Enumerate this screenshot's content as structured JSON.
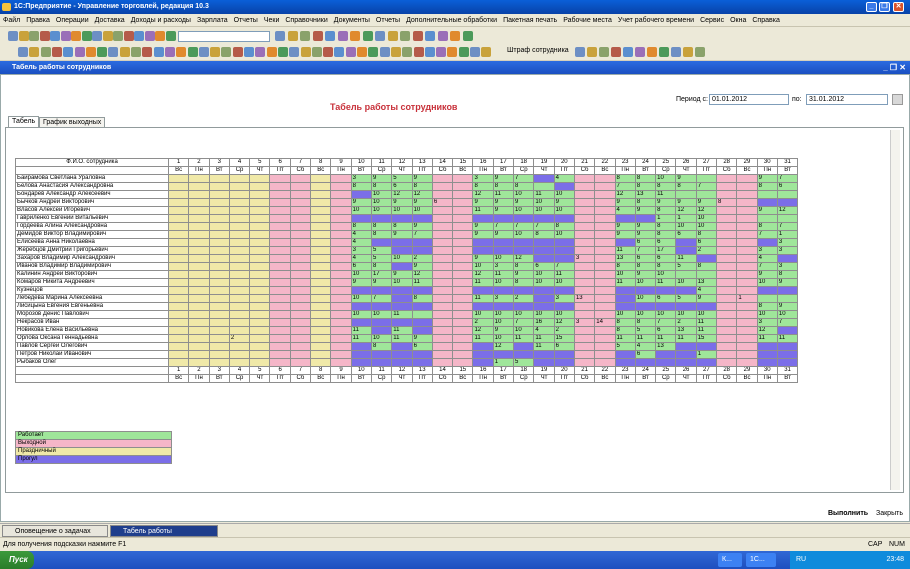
{
  "window": {
    "title": "1С:Предприятие - Управление торговлей, редакция 10.3",
    "min": "_",
    "restore": "❐",
    "close": "✕"
  },
  "menu": [
    "Файл",
    "Правка",
    "Операции",
    "Доставка",
    "Доходы и расходы",
    "Зарплата",
    "Отчеты",
    "Чеки",
    "Справочники",
    "Документы",
    "Отчеты",
    "Дополнительные обработки",
    "Пакетная печать",
    "Рабочие места",
    "Учет рабочего времени",
    "Сервис",
    "Окна",
    "Справка"
  ],
  "toolbar": {
    "search_placeholder": "",
    "penalty_label": "Штраф сотрудника"
  },
  "doc": {
    "title": "Табель работы сотрудников"
  },
  "report": {
    "title": "Табель работы сотрудников",
    "period_from_label": "Период с:",
    "period_from": "01.01.2012",
    "period_to_label": "по:",
    "period_to": "31.01.2012",
    "tabs": [
      "Табель",
      "График выходных"
    ],
    "name_header": "Ф.И.О. сотрудника",
    "days": [
      "1",
      "2",
      "3",
      "4",
      "5",
      "6",
      "7",
      "8",
      "9",
      "10",
      "11",
      "12",
      "13",
      "14",
      "15",
      "16",
      "17",
      "18",
      "19",
      "20",
      "21",
      "22",
      "23",
      "24",
      "25",
      "26",
      "27",
      "28",
      "29",
      "30",
      "31"
    ],
    "weekdays": [
      "Вс",
      "Пн",
      "Вт",
      "Ср",
      "Чт",
      "Пт",
      "Сб",
      "Вс",
      "Пн",
      "Вт",
      "Ср",
      "Чт",
      "Пт",
      "Сб",
      "Вс",
      "Пн",
      "Вт",
      "Ср",
      "Чт",
      "Пт",
      "Сб",
      "Вс",
      "Пн",
      "Вт",
      "Ср",
      "Чт",
      "Пт",
      "Сб",
      "Вс",
      "Пн",
      "Вт"
    ],
    "day_types": [
      "hol",
      "hol",
      "hol",
      "hol",
      "hol",
      "off",
      "off",
      "hol",
      "off",
      "",
      "",
      "",
      "",
      "off",
      "off",
      "",
      "",
      "",
      "",
      "",
      "off",
      "off",
      "",
      "",
      "",
      "",
      "",
      "off",
      "off",
      "",
      ""
    ],
    "rows": [
      {
        "name": "Байрамова Светлана Ураловна",
        "cells": {
          "10": "3",
          "11": "9",
          "12": "5",
          "13": "9",
          "16": "3",
          "17": "9",
          "18": "7",
          "20": "4",
          "23": "8",
          "24": "8",
          "25": "10",
          "26": "9",
          "30": "9",
          "31": "7"
        }
      },
      {
        "name": "Белова Анастасия Александровна",
        "cells": {
          "10": "8",
          "11": "8",
          "12": "6",
          "13": "8",
          "16": "8",
          "17": "8",
          "18": "8",
          "23": "7",
          "24": "8",
          "25": "8",
          "26": "8",
          "27": "7",
          "30": "8",
          "31": "6"
        }
      },
      {
        "name": "Бондарев Александр Алексеевич",
        "cells": {
          "11": "10",
          "12": "12",
          "13": "12",
          "16": "12",
          "17": "11",
          "18": "10",
          "19": "11",
          "20": "10",
          "23": "12",
          "24": "13",
          "25": "11"
        }
      },
      {
        "name": "Бычков Андрей Викторович",
        "cells": {
          "10": "9",
          "11": "10",
          "12": "9",
          "13": "9",
          "14": "6",
          "16": "9",
          "17": "9",
          "18": "9",
          "19": "10",
          "20": "9",
          "23": "9",
          "24": "8",
          "25": "9",
          "26": "9",
          "27": "9",
          "28": "8"
        }
      },
      {
        "name": "Власов Алексей Игоревич",
        "cells": {
          "10": "10",
          "11": "10",
          "12": "10",
          "13": "10",
          "16": "11",
          "17": "9",
          "18": "10",
          "19": "10",
          "20": "10",
          "23": "4",
          "24": "9",
          "25": "8",
          "26": "12",
          "27": "12",
          "30": "9",
          "31": "12"
        }
      },
      {
        "name": "Гавриленко Евгений Витальевич",
        "cells": {
          "25": "1",
          "26": "1",
          "27": "10"
        }
      },
      {
        "name": "Гордеева Алина Александровна",
        "cells": {
          "10": "8",
          "11": "8",
          "12": "8",
          "13": "9",
          "16": "9",
          "17": "7",
          "18": "7",
          "19": "7",
          "20": "8",
          "23": "9",
          "24": "9",
          "25": "8",
          "26": "10",
          "27": "10",
          "30": "8",
          "31": "7"
        }
      },
      {
        "name": "Демидов Виктор Владимирович",
        "cells": {
          "10": "4",
          "11": "8",
          "12": "9",
          "13": "7",
          "16": "9",
          "17": "9",
          "18": "10",
          "19": "8",
          "20": "10",
          "23": "9",
          "24": "9",
          "25": "8",
          "26": "6",
          "27": "8",
          "30": "7",
          "31": "1"
        }
      },
      {
        "name": "Елисеева Анна Николаевна",
        "cells": {
          "10": "4",
          "24": "6",
          "25": "6",
          "27": "6",
          "31": "3"
        }
      },
      {
        "name": "Жеребцов Дмитрий Григорьевич",
        "cells": {
          "10": "3",
          "11": "5",
          "23": "11",
          "24": "7",
          "25": "17",
          "27": "2",
          "30": "3",
          "31": "3"
        }
      },
      {
        "name": "Захаров Владимир Александрович",
        "cells": {
          "10": "4",
          "11": "5",
          "12": "10",
          "13": "2",
          "16": "9",
          "17": "10",
          "18": "12",
          "21": "3",
          "23": "13",
          "24": "6",
          "25": "6",
          "26": "11",
          "30": "4"
        }
      },
      {
        "name": "Иванов Владимир Владимирович",
        "cells": {
          "10": "6",
          "11": "8",
          "13": "9",
          "16": "10",
          "17": "3",
          "18": "8",
          "19": "6",
          "20": "7",
          "23": "8",
          "24": "8",
          "25": "8",
          "26": "5",
          "27": "8",
          "30": "7",
          "31": "3"
        }
      },
      {
        "name": "Калинин Андрей Викторович",
        "cells": {
          "10": "10",
          "11": "17",
          "12": "9",
          "13": "12",
          "16": "12",
          "17": "11",
          "18": "9",
          "19": "10",
          "20": "11",
          "23": "10",
          "24": "9",
          "25": "10",
          "30": "9",
          "31": "8"
        }
      },
      {
        "name": "Комаров Никита Андреевич",
        "cells": {
          "10": "9",
          "11": "9",
          "12": "10",
          "13": "11",
          "16": "11",
          "17": "10",
          "18": "8",
          "19": "10",
          "20": "10",
          "23": "11",
          "24": "10",
          "25": "11",
          "26": "10",
          "27": "13",
          "30": "10",
          "31": "9"
        }
      },
      {
        "name": "Кузнецов",
        "cells": {
          "27": "4"
        }
      },
      {
        "name": "Лебедева Марина Алексеевна",
        "cells": {
          "10": "10",
          "11": "7",
          "13": "8",
          "16": "11",
          "17": "3",
          "18": "2",
          "20": "3",
          "21": "13",
          "24": "10",
          "25": "6",
          "26": "5",
          "27": "9",
          "29": "1"
        }
      },
      {
        "name": "Лисицына Евгения Евгеньевна",
        "cells": {
          "30": "8",
          "31": "9"
        }
      },
      {
        "name": "Морозов Денис Павлович",
        "cells": {
          "10": "10",
          "11": "10",
          "12": "11",
          "16": "10",
          "17": "10",
          "18": "10",
          "19": "10",
          "20": "10",
          "23": "10",
          "24": "10",
          "25": "10",
          "26": "10",
          "27": "10",
          "30": "10",
          "31": "10"
        }
      },
      {
        "name": "Некрасов Иван",
        "cells": {
          "16": "2",
          "17": "10",
          "18": "7",
          "19": "16",
          "20": "12",
          "21": "3",
          "22": "14",
          "23": "8",
          "24": "8",
          "25": "7",
          "26": "2",
          "27": "11",
          "30": "3",
          "31": "7"
        }
      },
      {
        "name": "Новикова Елена Васильевна",
        "cells": {
          "10": "11",
          "12": "11",
          "16": "12",
          "17": "9",
          "18": "10",
          "19": "4",
          "20": "2",
          "23": "8",
          "24": "5",
          "25": "6",
          "26": "13",
          "27": "11",
          "30": "12"
        }
      },
      {
        "name": "Орлова Оксана Геннадьевна",
        "cells": {
          "4": "2",
          "10": "11",
          "11": "10",
          "12": "11",
          "13": "9",
          "16": "11",
          "17": "10",
          "18": "11",
          "19": "11",
          "20": "15",
          "23": "11",
          "24": "11",
          "25": "11",
          "26": "11",
          "27": "15",
          "30": "11",
          "31": "11"
        }
      },
      {
        "name": "Павлов Сергей Олегович",
        "cells": {
          "11": "8",
          "13": "6",
          "17": "12",
          "19": "11",
          "20": "6",
          "23": "5",
          "24": "4",
          "25": "13"
        }
      },
      {
        "name": "Петров Николай Иванович",
        "cells": {
          "24": "6",
          "27": "1"
        }
      },
      {
        "name": "Рыбаков Олег",
        "cells": {
          "17": "1",
          "18": "5"
        }
      }
    ],
    "abs_cells": [
      [
        0,
        19
      ],
      [
        0,
        21
      ],
      [
        1,
        20
      ],
      [
        2,
        10
      ],
      [
        2,
        13
      ],
      [
        3,
        30
      ],
      [
        3,
        31
      ],
      [
        4,
        21
      ],
      [
        5,
        10
      ],
      [
        5,
        11
      ],
      [
        5,
        12
      ],
      [
        5,
        13
      ],
      [
        5,
        16
      ],
      [
        5,
        17
      ],
      [
        5,
        18
      ],
      [
        5,
        19
      ],
      [
        5,
        20
      ],
      [
        5,
        23
      ],
      [
        5,
        24
      ],
      [
        6,
        21
      ],
      [
        7,
        21
      ],
      [
        8,
        11
      ],
      [
        8,
        12
      ],
      [
        8,
        13
      ],
      [
        8,
        16
      ],
      [
        8,
        17
      ],
      [
        8,
        18
      ],
      [
        8,
        19
      ],
      [
        8,
        20
      ],
      [
        8,
        23
      ],
      [
        8,
        26
      ],
      [
        8,
        30
      ],
      [
        9,
        12
      ],
      [
        9,
        13
      ],
      [
        9,
        16
      ],
      [
        9,
        17
      ],
      [
        9,
        18
      ],
      [
        9,
        19
      ],
      [
        9,
        20
      ],
      [
        9,
        26
      ],
      [
        10,
        19
      ],
      [
        10,
        20
      ],
      [
        10,
        27
      ],
      [
        10,
        31
      ],
      [
        11,
        12
      ],
      [
        13,
        31
      ],
      [
        14,
        10
      ],
      [
        14,
        11
      ],
      [
        14,
        12
      ],
      [
        14,
        13
      ],
      [
        14,
        16
      ],
      [
        14,
        17
      ],
      [
        14,
        18
      ],
      [
        14,
        19
      ],
      [
        14,
        20
      ],
      [
        14,
        23
      ],
      [
        14,
        24
      ],
      [
        14,
        25
      ],
      [
        14,
        26
      ],
      [
        14,
        30
      ],
      [
        14,
        31
      ],
      [
        15,
        12
      ],
      [
        15,
        19
      ],
      [
        15,
        23
      ],
      [
        16,
        10
      ],
      [
        16,
        11
      ],
      [
        16,
        12
      ],
      [
        16,
        13
      ],
      [
        16,
        16
      ],
      [
        16,
        17
      ],
      [
        16,
        18
      ],
      [
        16,
        19
      ],
      [
        16,
        20
      ],
      [
        16,
        23
      ],
      [
        16,
        24
      ],
      [
        16,
        25
      ],
      [
        16,
        26
      ],
      [
        16,
        27
      ],
      [
        18,
        10
      ],
      [
        18,
        11
      ],
      [
        18,
        12
      ],
      [
        18,
        13
      ],
      [
        19,
        11
      ],
      [
        19,
        13
      ],
      [
        19,
        31
      ],
      [
        20,
        31
      ],
      [
        21,
        10
      ],
      [
        21,
        12
      ],
      [
        21,
        16
      ],
      [
        21,
        18
      ],
      [
        21,
        26
      ],
      [
        21,
        27
      ],
      [
        21,
        30
      ],
      [
        21,
        31
      ],
      [
        22,
        10
      ],
      [
        22,
        11
      ],
      [
        22,
        12
      ],
      [
        22,
        13
      ],
      [
        22,
        16
      ],
      [
        22,
        17
      ],
      [
        22,
        18
      ],
      [
        22,
        19
      ],
      [
        22,
        20
      ],
      [
        22,
        23
      ],
      [
        22,
        25
      ],
      [
        22,
        26
      ],
      [
        22,
        30
      ],
      [
        22,
        31
      ],
      [
        23,
        10
      ],
      [
        23,
        11
      ],
      [
        23,
        12
      ],
      [
        23,
        13
      ],
      [
        23,
        16
      ],
      [
        23,
        19
      ],
      [
        23,
        20
      ],
      [
        23,
        23
      ],
      [
        23,
        24
      ],
      [
        23,
        25
      ],
      [
        23,
        26
      ],
      [
        23,
        27
      ],
      [
        23,
        30
      ],
      [
        23,
        31
      ]
    ],
    "legend": [
      {
        "label": "Работает",
        "type": "work"
      },
      {
        "label": "Выходной",
        "type": "off"
      },
      {
        "label": "Праздничный",
        "type": "hol"
      },
      {
        "label": "Прогул",
        "type": "abs"
      }
    ],
    "colors": {
      "hol": "#f0e9a8",
      "off": "#f5b6c8",
      "work": "#9fe69a",
      "abs": "#7b6ee8"
    }
  },
  "actions": {
    "execute": "Выполнить",
    "close": "Закрыть"
  },
  "window_tabs": [
    "Оповещение о задачах",
    "Табель работы сотрудников"
  ],
  "status": {
    "hint": "Для получения подсказки нажмите F1",
    "caps": "CAP",
    "num": "NUM"
  },
  "taskbar": {
    "start": "Пуск",
    "items": [
      "К...",
      "1С..."
    ],
    "lang": "RU",
    "time": "23:48"
  }
}
